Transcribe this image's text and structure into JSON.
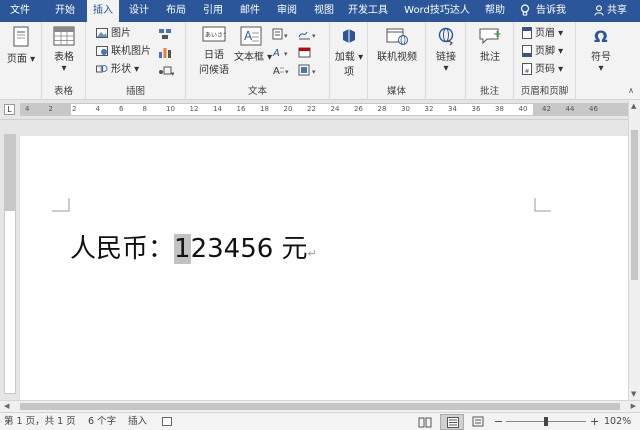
{
  "tabs": [
    {
      "label": "文件",
      "active": false
    },
    {
      "label": "开始",
      "active": false
    },
    {
      "label": "插入",
      "active": true
    },
    {
      "label": "设计",
      "active": false
    },
    {
      "label": "布局",
      "active": false
    },
    {
      "label": "引用",
      "active": false
    },
    {
      "label": "邮件",
      "active": false
    },
    {
      "label": "审阅",
      "active": false
    },
    {
      "label": "视图",
      "active": false
    },
    {
      "label": "开发工具",
      "active": false
    },
    {
      "label": "Word技巧达人",
      "active": false
    },
    {
      "label": "帮助",
      "active": false
    }
  ],
  "tell_me": "告诉我",
  "share": "共享",
  "ribbon": {
    "pages_label": "页面",
    "table_label": "表格",
    "table_group": "表格",
    "picture": "图片",
    "online_picture": "联机图片",
    "shapes": "形状",
    "illustrations_group": "插图",
    "japanese_1": "日语",
    "japanese_2": "问候语",
    "textbox": "文本框",
    "text_group": "文本",
    "addin_1": "加载",
    "addin_2": "项",
    "online_video": "联机视频",
    "media_group": "媒体",
    "link": "链接",
    "comment": "批注",
    "comments_group": "批注",
    "header": "页眉",
    "footer": "页脚",
    "page_number": "页码",
    "header_footer_group": "页眉和页脚",
    "symbol": "符号"
  },
  "ruler_numbers": [
    "4",
    "2",
    "2",
    "4",
    "6",
    "8",
    "10",
    "12",
    "14",
    "16",
    "18",
    "20",
    "22",
    "24",
    "26",
    "28",
    "30",
    "32",
    "34",
    "36",
    "38",
    "40",
    "42",
    "44",
    "46"
  ],
  "document": {
    "before": "人民币：",
    "selected": "1",
    "after": "23456 元"
  },
  "status": {
    "page": "第 1 页，共 1 页",
    "words": "6 个字",
    "mode": "插入",
    "zoom": "102%",
    "zoom_minus": "−",
    "zoom_plus": "+"
  },
  "colors": {
    "brand": "#2b579a",
    "selection": "#c2c2c2"
  }
}
